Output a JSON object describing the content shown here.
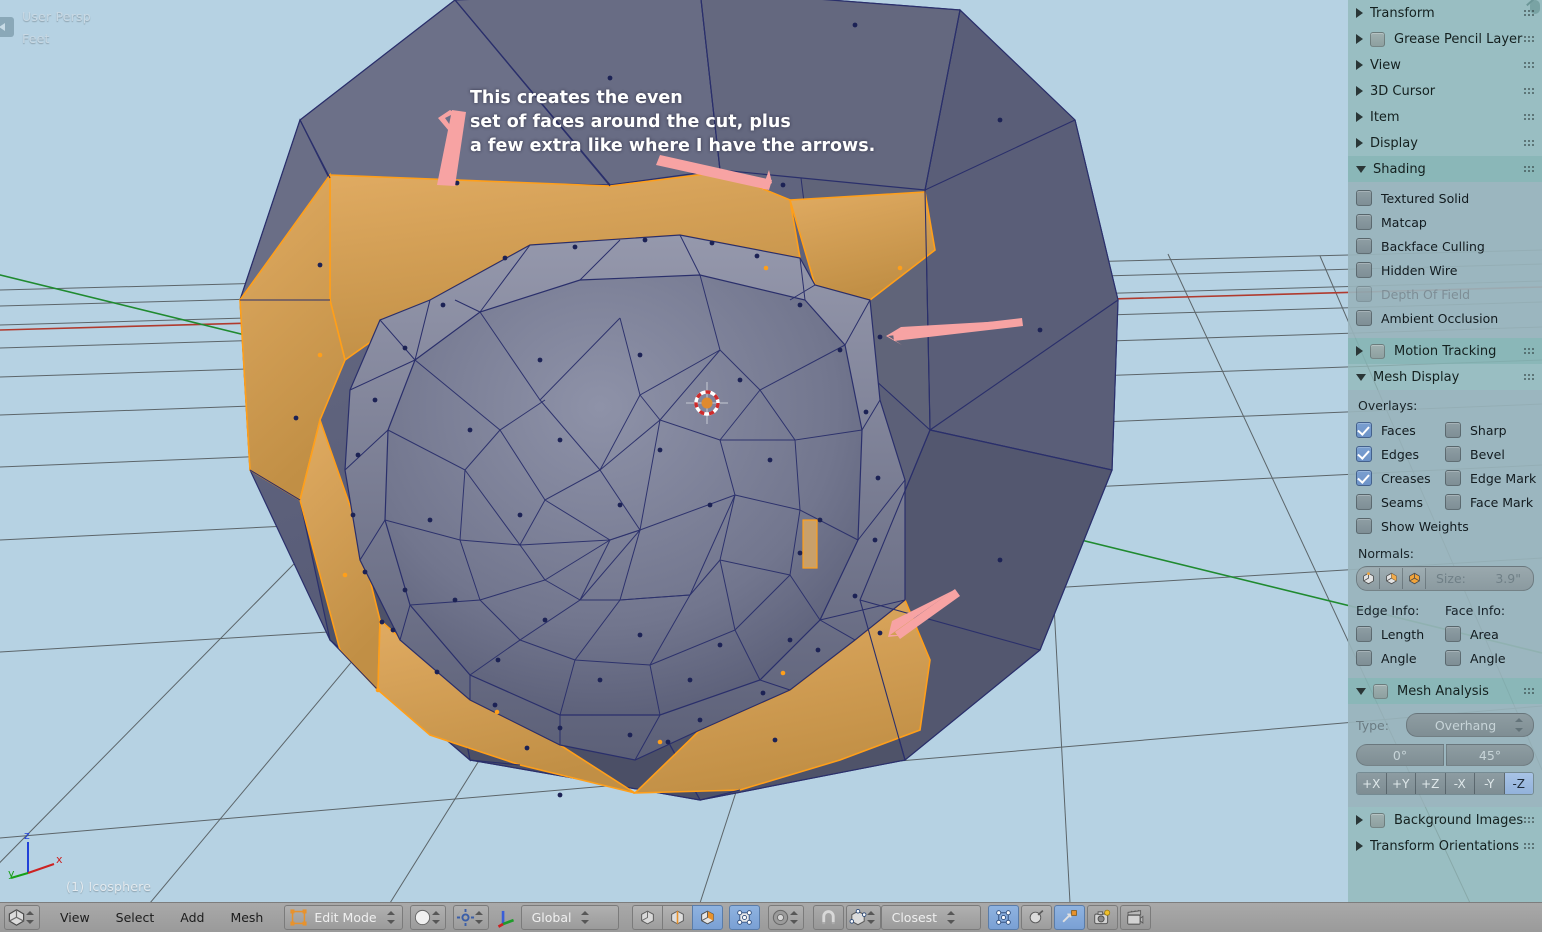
{
  "viewport": {
    "perspective_label": "User Persp",
    "units_label": "Feet",
    "object_name": "(1) Icosphere",
    "annotation": "This creates the even\nset of faces around the cut, plus\na few extra like where I have the arrows.",
    "axis_gizmo": {
      "z": "z",
      "y": "y",
      "x": "x"
    },
    "colors": {
      "background": "#b6d2e3",
      "grid_line": "#4d5355",
      "axis_x": "#c0392b",
      "axis_y": "#1f8a2f",
      "mesh_face": "#6b7087",
      "mesh_face_dark": "#4c506a",
      "selected_face": "#d89f4f",
      "selected_edge": "#ff9f1a",
      "wire_edge": "#2a2f6b",
      "arrow": "#f5a0a0",
      "cursor_center": "#e08a2e"
    }
  },
  "properties_panel": {
    "panels": [
      {
        "name": "Transform",
        "label": "Transform",
        "open": false,
        "checkbox": false,
        "selected": false
      },
      {
        "name": "Grease Pencil Layers",
        "label": "Grease Pencil Layers",
        "open": false,
        "checkbox": true,
        "selected": false
      },
      {
        "name": "View",
        "label": "View",
        "open": false,
        "checkbox": false,
        "selected": false
      },
      {
        "name": "3D Cursor",
        "label": "3D Cursor",
        "open": false,
        "checkbox": false,
        "selected": false
      },
      {
        "name": "Item",
        "label": "Item",
        "open": false,
        "checkbox": false,
        "selected": false
      },
      {
        "name": "Display",
        "label": "Display",
        "open": false,
        "checkbox": false,
        "selected": false
      },
      {
        "name": "Shading",
        "label": "Shading",
        "open": true,
        "checkbox": false,
        "selected": true
      },
      {
        "name": "Motion Tracking",
        "label": "Motion Tracking",
        "open": false,
        "checkbox": true,
        "selected": true
      },
      {
        "name": "Mesh Display",
        "label": "Mesh Display",
        "open": true,
        "checkbox": false,
        "selected": false
      },
      {
        "name": "Mesh Analysis",
        "label": "Mesh Analysis",
        "open": true,
        "checkbox": true,
        "selected": true
      },
      {
        "name": "Background Images",
        "label": "Background Images",
        "open": false,
        "checkbox": true,
        "selected": false
      },
      {
        "name": "Transform Orientations",
        "label": "Transform Orientations",
        "open": false,
        "checkbox": false,
        "selected": false
      }
    ],
    "shading": {
      "options": [
        {
          "label": "Textured Solid",
          "checked": false,
          "disabled": false
        },
        {
          "label": "Matcap",
          "checked": false,
          "disabled": false
        },
        {
          "label": "Backface Culling",
          "checked": false,
          "disabled": false
        },
        {
          "label": "Hidden Wire",
          "checked": false,
          "disabled": false
        },
        {
          "label": "Depth Of Field",
          "checked": false,
          "disabled": true
        },
        {
          "label": "Ambient Occlusion",
          "checked": false,
          "disabled": false
        }
      ]
    },
    "mesh_display": {
      "overlays_label": "Overlays:",
      "overlays_left": [
        {
          "label": "Faces",
          "checked": true
        },
        {
          "label": "Edges",
          "checked": true
        },
        {
          "label": "Creases",
          "checked": true
        },
        {
          "label": "Seams",
          "checked": false
        },
        {
          "label": "Show Weights",
          "checked": false
        }
      ],
      "overlays_right": [
        {
          "label": "Sharp",
          "checked": false
        },
        {
          "label": "Bevel",
          "checked": false
        },
        {
          "label": "Edge Mark",
          "checked": false
        },
        {
          "label": "Face Mark",
          "checked": false
        }
      ],
      "normals_label": "Normals:",
      "normals_size_label": "Size:",
      "normals_size_value": "3.9\"",
      "normals_modes": [
        "vertex-normal",
        "split-normal",
        "face-normal"
      ],
      "edge_info_label": "Edge Info:",
      "edge_info": [
        {
          "label": "Length",
          "checked": false
        },
        {
          "label": "Angle",
          "checked": false
        }
      ],
      "face_info_label": "Face Info:",
      "face_info": [
        {
          "label": "Area",
          "checked": false
        },
        {
          "label": "Angle",
          "checked": false
        }
      ]
    },
    "mesh_analysis": {
      "type_label": "Type:",
      "type_value": "Overhang",
      "range_min": "0°",
      "range_max": "45°",
      "axis_buttons": [
        {
          "label": "+X",
          "active": false
        },
        {
          "label": "+Y",
          "active": false
        },
        {
          "label": "+Z",
          "active": false
        },
        {
          "label": "-X",
          "active": false
        },
        {
          "label": "-Y",
          "active": false
        },
        {
          "label": "-Z",
          "active": true
        }
      ]
    }
  },
  "bottom_bar": {
    "editor_type_icon": "editor-type-3dview-icon",
    "menus": [
      "View",
      "Select",
      "Add",
      "Mesh"
    ],
    "mode_icon": "edit-mode-icon",
    "mode_value": "Edit Mode",
    "viewport_shading_icon": "solid-shading-icon",
    "pivot_icon": "pivot-median-point-icon",
    "orientation_icon": "transform-orientation-axis-icon",
    "orientation_value": "Global",
    "select_modes": [
      {
        "icon": "vertex-select-icon",
        "label": "Vertex",
        "active": false
      },
      {
        "icon": "edge-select-icon",
        "label": "Edge",
        "active": false
      },
      {
        "icon": "face-select-icon",
        "label": "Face",
        "active": true
      }
    ],
    "limit_to_visible_icon": "limit-selection-to-visible-icon",
    "proportional_icon": "proportional-editing-icon",
    "snap_magnet_icon": "snap-magnet-icon",
    "snap_target_icon": "snap-element-vertex-icon",
    "snap_value": "Closest",
    "overlay_icons": [
      {
        "icon": "mesh-symmetry-icon",
        "active": true
      },
      {
        "icon": "occlude-geometry-icon",
        "active": false
      },
      {
        "icon": "auto-merge-icon",
        "active": true
      },
      {
        "icon": "render-image-icon",
        "active": false
      },
      {
        "icon": "render-animation-icon",
        "active": false
      }
    ]
  }
}
